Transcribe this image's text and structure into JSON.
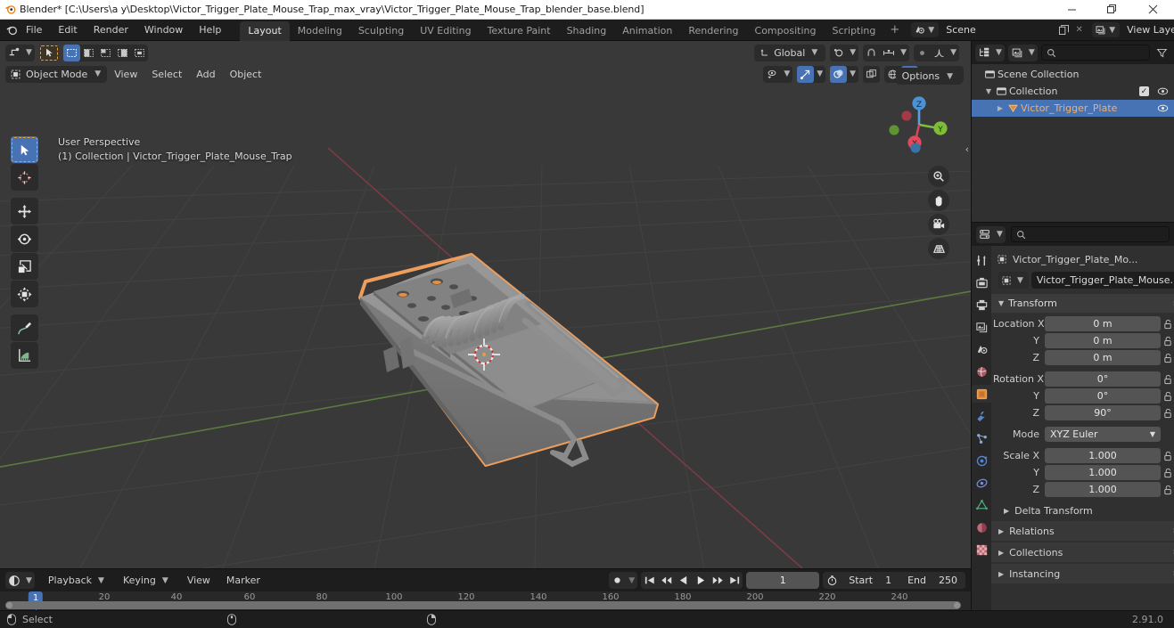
{
  "window": {
    "title": "Blender* [C:\\Users\\a y\\Desktop\\Victor_Trigger_Plate_Mouse_Trap_max_vray\\Victor_Trigger_Plate_Mouse_Trap_blender_base.blend]",
    "minimize": "—",
    "maximize": "❐",
    "close": "✕"
  },
  "topbar": {
    "menus": [
      "File",
      "Edit",
      "Render",
      "Window",
      "Help"
    ],
    "workspaces": [
      {
        "label": "Layout",
        "active": true
      },
      {
        "label": "Modeling",
        "active": false
      },
      {
        "label": "Sculpting",
        "active": false
      },
      {
        "label": "UV Editing",
        "active": false
      },
      {
        "label": "Texture Paint",
        "active": false
      },
      {
        "label": "Shading",
        "active": false
      },
      {
        "label": "Animation",
        "active": false
      },
      {
        "label": "Rendering",
        "active": false
      },
      {
        "label": "Compositing",
        "active": false
      },
      {
        "label": "Scripting",
        "active": false
      }
    ],
    "add_workspace": "+",
    "scene_name": "Scene",
    "view_layer_name": "View Layer"
  },
  "viewport": {
    "transform_orientation": "Global",
    "options_label": "Options",
    "mode": "Object Mode",
    "menus": [
      "View",
      "Select",
      "Add",
      "Object"
    ],
    "overlay_line1": "User Perspective",
    "overlay_line2": "(1) Collection | Victor_Trigger_Plate_Mouse_Trap",
    "gizmo_axes": {
      "x": "X",
      "y": "Y",
      "z": "Z"
    },
    "tools": [
      "tweak-select-tool",
      "cursor-tool",
      "move-tool",
      "rotate-tool",
      "scale-tool",
      "transform-tool",
      "annotate-tool",
      "measure-tool"
    ],
    "nav_buttons": [
      "zoom-icon",
      "pan-hand-icon",
      "camera-icon",
      "perspective-grid-icon"
    ],
    "accent_select": "#ED9E5C",
    "background": "#393939"
  },
  "outliner": {
    "search_placeholder": "",
    "rows": [
      {
        "name": "Scene Collection",
        "icon": "collection-icon",
        "depth": 0,
        "selected": false,
        "expander": "",
        "checkbox": false,
        "eye": false
      },
      {
        "name": "Collection",
        "icon": "collection-icon",
        "depth": 1,
        "selected": false,
        "expander": "▼",
        "checkbox": true,
        "eye": true
      },
      {
        "name": "Victor_Trigger_Plate",
        "icon": "mesh-object-icon",
        "depth": 2,
        "selected": true,
        "expander": "▶",
        "checkbox": false,
        "eye": true
      }
    ]
  },
  "properties": {
    "search_placeholder": "",
    "breadcrumb_name": "Victor_Trigger_Plate_Mo...",
    "object_name": "Victor_Trigger_Plate_Mouse...",
    "tabs": [
      {
        "name": "tool-tab",
        "active": false
      },
      {
        "name": "render-tab",
        "active": false
      },
      {
        "name": "output-tab",
        "active": false
      },
      {
        "name": "view-layer-tab",
        "active": false
      },
      {
        "name": "scene-tab",
        "active": false
      },
      {
        "name": "world-tab",
        "active": false
      },
      {
        "name": "object-tab",
        "active": true
      },
      {
        "name": "modifier-tab",
        "active": false
      },
      {
        "name": "particles-tab",
        "active": false
      },
      {
        "name": "physics-tab",
        "active": false
      },
      {
        "name": "constraints-tab",
        "active": false
      },
      {
        "name": "data-tab",
        "active": false
      },
      {
        "name": "material-tab",
        "active": false
      },
      {
        "name": "texture-tab",
        "active": false
      }
    ],
    "transform": {
      "title": "Transform",
      "location": {
        "label": "Location X",
        "x": "0 m",
        "y": "0 m",
        "z": "0 m"
      },
      "rotation": {
        "label": "Rotation X",
        "x": "0°",
        "y": "0°",
        "z": "90°"
      },
      "mode": {
        "label": "Mode",
        "value": "XYZ Euler"
      },
      "scale": {
        "label": "Scale X",
        "x": "1.000",
        "y": "1.000",
        "z": "1.000"
      },
      "axis_y": "Y",
      "axis_z": "Z"
    },
    "panels": [
      {
        "label": "Delta Transform",
        "sub": true
      },
      {
        "label": "Relations",
        "sub": false
      },
      {
        "label": "Collections",
        "sub": false
      },
      {
        "label": "Instancing",
        "sub": false
      }
    ]
  },
  "timeline": {
    "menus": [
      "Playback",
      "Keying",
      "View",
      "Marker"
    ],
    "current_frame": "1",
    "start_label": "Start",
    "start_value": "1",
    "end_label": "End",
    "end_value": "250",
    "ticks": [
      "20",
      "40",
      "60",
      "80",
      "100",
      "120",
      "140",
      "160",
      "180",
      "200",
      "220",
      "240"
    ],
    "playhead_label": "1"
  },
  "statusbar": {
    "select_label": "Select",
    "version": "2.91.0"
  }
}
